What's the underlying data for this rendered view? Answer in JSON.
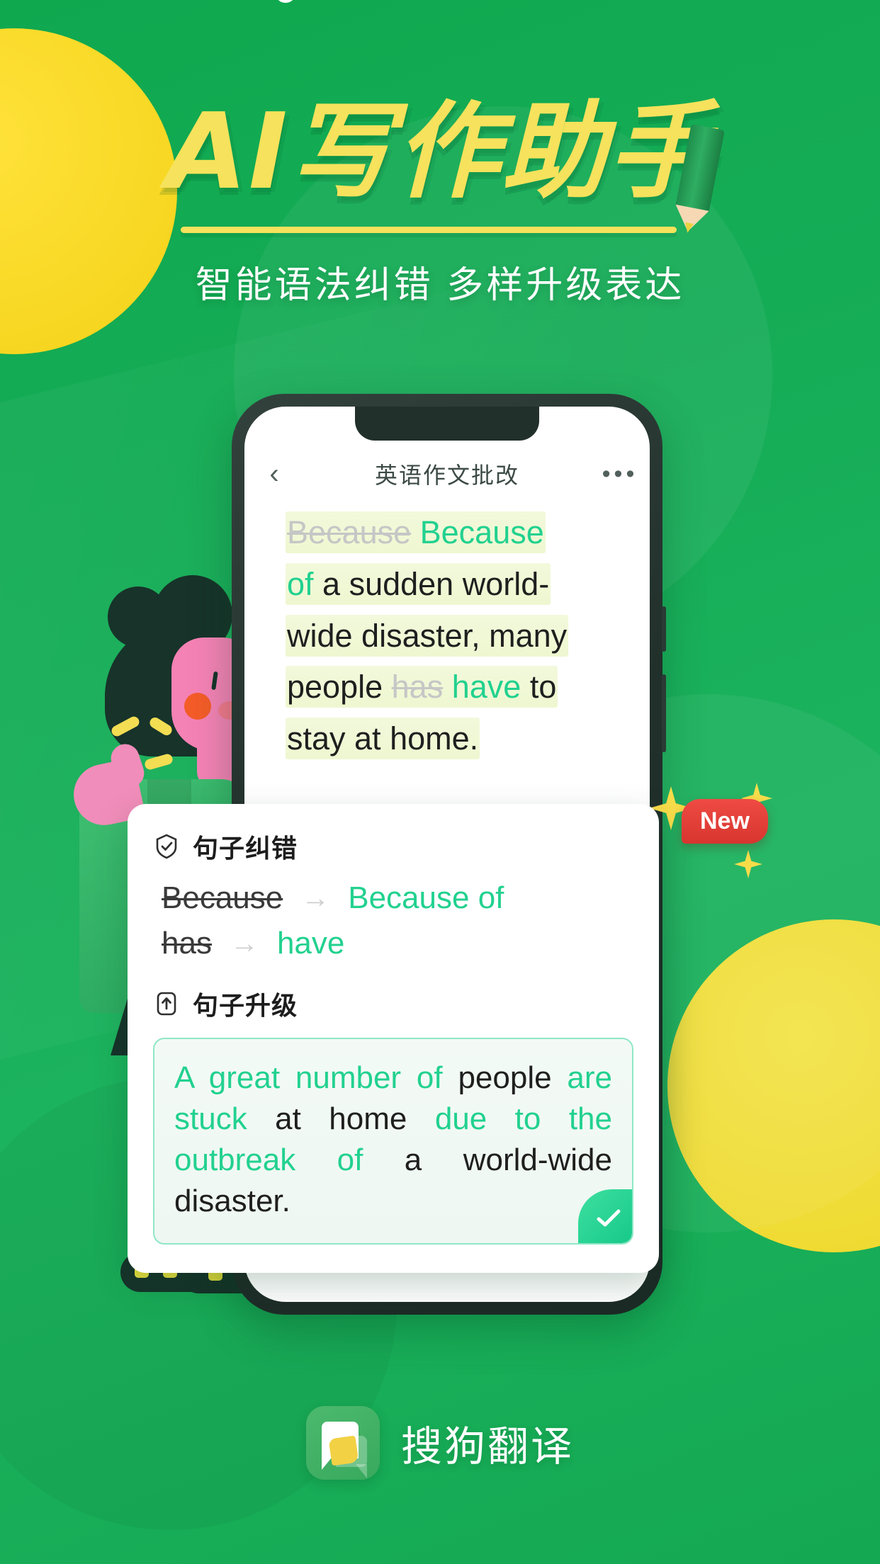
{
  "hero": {
    "title": "AI写作助手",
    "subtitle": "智能语法纠错  多样升级表达",
    "accent_yellow": "#f6e25c",
    "background_green": "#12a34f"
  },
  "phone": {
    "nav": {
      "back_icon": "chevron-left-icon",
      "title": "英语作文批改",
      "more_icon": "ellipsis-icon"
    },
    "essay": {
      "lines": [
        [
          {
            "text": "Because",
            "style": "strike"
          },
          {
            "text": " Because",
            "style": "fix"
          }
        ],
        [
          {
            "text": "of",
            "style": "fix"
          },
          {
            "text": " a sudden world-",
            "style": "normal"
          }
        ],
        [
          {
            "text": "wide disaster, many",
            "style": "normal"
          }
        ],
        [
          {
            "text": "people ",
            "style": "normal"
          },
          {
            "text": "has",
            "style": "strike"
          },
          {
            "text": " have",
            "style": "fix"
          },
          {
            "text": " to",
            "style": "normal"
          }
        ],
        [
          {
            "text": "stay at home.",
            "style": "normal"
          }
        ]
      ]
    }
  },
  "card": {
    "correction": {
      "icon": "shield-check-icon",
      "title": "句子纠错",
      "arrow": "→",
      "rows": [
        {
          "old": "Because",
          "new": "Because of"
        },
        {
          "old": "has",
          "new": "have"
        }
      ]
    },
    "upgrade": {
      "icon": "arrow-up-box-icon",
      "title": "句子升级",
      "sentence": [
        {
          "text": "A great number of ",
          "style": "green"
        },
        {
          "text": "people are ",
          "style": "mixed-people"
        },
        {
          "text": "stuck",
          "style": "green"
        },
        {
          "text": " at home ",
          "style": "normal"
        },
        {
          "text": "due to the outbreak of",
          "style": "green"
        },
        {
          "text": " a world-wide disaster.",
          "style": "normal"
        }
      ],
      "sentence_plain": "A great number of people are stuck at home due to the outbreak of a world-wide disaster.",
      "accept_icon": "check-icon",
      "accent_color": "#22d18f"
    }
  },
  "badge": {
    "label": "New",
    "color": "#e0413a",
    "sparkle_color": "#f7dc4a"
  },
  "illustration": {
    "name": "girl-with-thumbs-up",
    "hair_color": "#17332a",
    "skin_color": "#f582b5",
    "sock_color": "#e8e03f"
  },
  "brand": {
    "logo_icon": "sogou-chat-bubble-logo",
    "name": "搜狗翻译"
  }
}
